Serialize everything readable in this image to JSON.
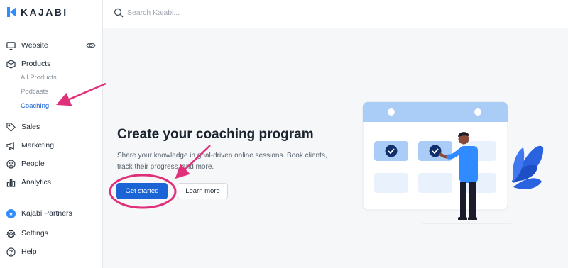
{
  "brand": {
    "name": "KAJABI",
    "accent": "#1a64d6",
    "logo_blue": "#2f8bff"
  },
  "search": {
    "placeholder": "Search Kajabi..."
  },
  "sidebar": {
    "items": [
      {
        "label": "Website",
        "icon": "monitor-icon"
      },
      {
        "label": "Products",
        "icon": "box-icon"
      },
      {
        "label": "Sales",
        "icon": "tag-icon"
      },
      {
        "label": "Marketing",
        "icon": "megaphone-icon"
      },
      {
        "label": "People",
        "icon": "user-circle-icon"
      },
      {
        "label": "Analytics",
        "icon": "bar-chart-icon"
      },
      {
        "label": "Kajabi Partners",
        "icon": "star-badge-icon"
      },
      {
        "label": "Settings",
        "icon": "gear-icon"
      },
      {
        "label": "Help",
        "icon": "help-circle-icon"
      }
    ],
    "products_sub": [
      {
        "label": "All Products",
        "active": false
      },
      {
        "label": "Podcasts",
        "active": false
      },
      {
        "label": "Coaching",
        "active": true
      }
    ]
  },
  "main": {
    "title": "Create your coaching program",
    "description": "Share your knowledge in goal-driven online sessions. Book clients, track their progress, and more.",
    "primary_button": "Get started",
    "secondary_button": "Learn more"
  },
  "annotations": {
    "color": "#e0307a"
  }
}
